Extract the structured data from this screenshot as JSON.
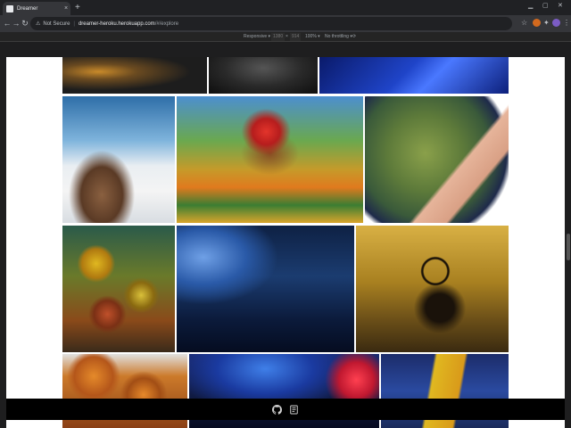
{
  "browser": {
    "tab_title": "Dreamer",
    "tab_close": "×",
    "new_tab": "+",
    "security_label": "Not Secure",
    "separator": "|",
    "url_host": "dreamer-heroku.herokuapp.com",
    "url_path": "/#/explore"
  },
  "device_toolbar": {
    "device": "Responsive ▾",
    "width": "1380",
    "times": "×",
    "height": "914",
    "zoom": "100% ▾",
    "throttle": "No throttling ▾"
  },
  "tiles": [
    {
      "name": "tile-food-bowl",
      "scene": "Bowl of food on a dark table"
    },
    {
      "name": "tile-dark-portrait",
      "scene": "Dark portrait"
    },
    {
      "name": "tile-blue-pyramid",
      "scene": "Blue pyramid structure"
    },
    {
      "name": "tile-man-above-clouds",
      "scene": "Man standing on a rock above the clouds"
    },
    {
      "name": "tile-fruit-vendor",
      "scene": "Woman at a colorful fruit stand"
    },
    {
      "name": "tile-fisheye-hand",
      "scene": "Fisheye view of a hand over a landscape"
    },
    {
      "name": "tile-bubble-tree",
      "scene": "Tree with colorful bubbles"
    },
    {
      "name": "tile-night-alley",
      "scene": "Figures in a blue night alley"
    },
    {
      "name": "tile-dreamcatcher",
      "scene": "Dreamcatcher silhouette at sunset"
    },
    {
      "name": "tile-fried-shrimp",
      "scene": "Plate of fried shrimp"
    },
    {
      "name": "tile-neon-crowd",
      "scene": "Crowd under neon light"
    },
    {
      "name": "tile-starry-cafe",
      "scene": "Starry night cafe painting"
    }
  ],
  "footer": {
    "icons": [
      "github-icon",
      "resume-icon"
    ]
  }
}
